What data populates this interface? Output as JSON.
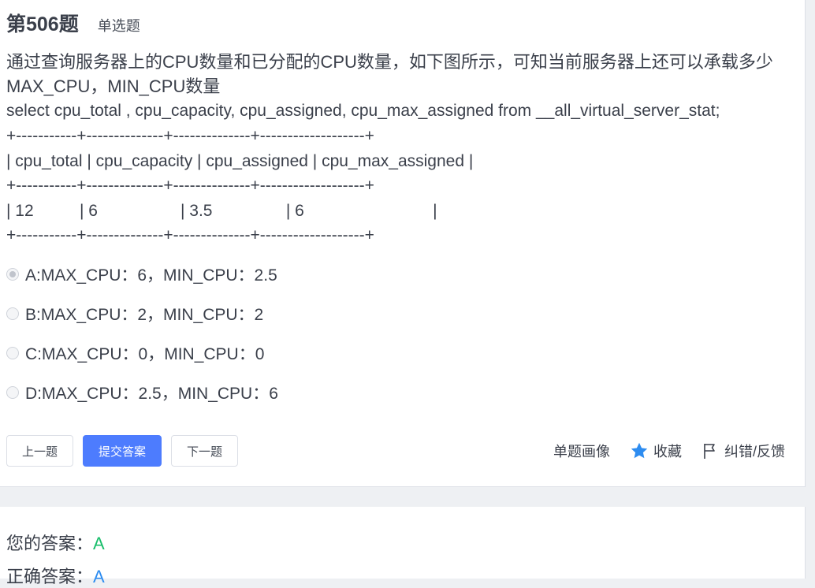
{
  "question": {
    "number": "第506题",
    "type": "单选题",
    "stem_line1": "通过查询服务器上的CPU数量和已分配的CPU数量，如下图所示，可知当前服务器上还可以承载多少",
    "stem_line2": "MAX_CPU，MIN_CPU数量",
    "sql": "select cpu_total , cpu_capacity, cpu_assigned, cpu_max_assigned from __all_virtual_server_stat;",
    "table_lines": [
      "+-----------+--------------+--------------+-------------------+",
      "| cpu_total | cpu_capacity | cpu_assigned | cpu_max_assigned |",
      "+-----------+--------------+--------------+-------------------+",
      "| 12          | 6                  | 3.5                | 6                            |",
      "+-----------+--------------+--------------+-------------------+"
    ]
  },
  "options": [
    {
      "label": "A:MAX_CPU：6，MIN_CPU：2.5",
      "checked": true
    },
    {
      "label": "B:MAX_CPU：2，MIN_CPU：2",
      "checked": false
    },
    {
      "label": "C:MAX_CPU：0，MIN_CPU：0",
      "checked": false
    },
    {
      "label": "D:MAX_CPU：2.5，MIN_CPU：6",
      "checked": false
    }
  ],
  "buttons": {
    "prev": "上一题",
    "submit": "提交答案",
    "next": "下一题"
  },
  "tools": {
    "portrait": "单题画像",
    "favorite": "收藏",
    "feedback": "纠错/反馈"
  },
  "answers": {
    "yours_label": "您的答案：",
    "yours_value": "A",
    "correct_label": "正确答案：",
    "correct_value": "A"
  },
  "colors": {
    "primary": "#4d7cfe",
    "your_answer": "#19be6b",
    "correct_answer": "#2d8cf0",
    "star": "#2d8cf0"
  }
}
